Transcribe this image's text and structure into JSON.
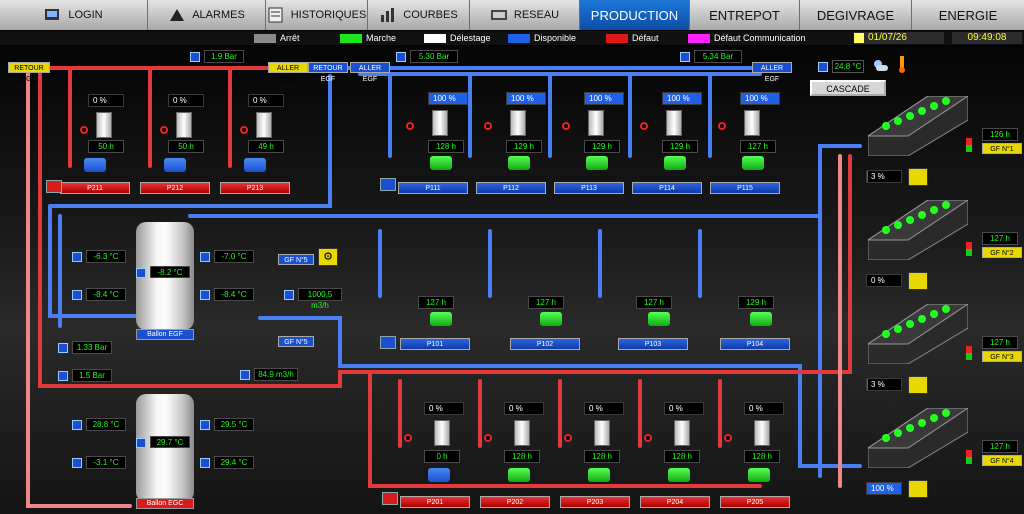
{
  "nav": {
    "login": "LOGIN",
    "alarms": "ALARMES",
    "history": "HISTORIQUES",
    "curves": "COURBES",
    "network": "RESEAU",
    "production": "PRODUCTION",
    "warehouse": "ENTREPOT",
    "defrost": "DEGIVRAGE",
    "energy": "ENERGIE"
  },
  "legend": {
    "stop": "Arrêt",
    "run": "Marche",
    "shed": "Délestage",
    "available": "Disponible",
    "fault": "Défaut",
    "comm_fault": "Défaut Communication",
    "date": "01/07/26",
    "time": "09:49:08"
  },
  "colors": {
    "stop": "#8a8a8a",
    "run": "#1ee61e",
    "shed": "#ffffff",
    "available": "#1e60e8",
    "fault": "#e01818",
    "comm_fault": "#ff22ff"
  },
  "top": {
    "p1": "1.9 Bar",
    "p2": "5.30 Bar",
    "p3": "5.34 Bar",
    "retour_egc": "RETOUR EGC",
    "aller_egc": "ALLER EGC",
    "retour_egf": "RETOUR EGF",
    "aller_egf1": "ALLER EGF",
    "aller_egf2": "ALLER EGF",
    "outdoor": "24.8 °C",
    "cascade": "CASCADE"
  },
  "egc_pumps": [
    {
      "name": "P211",
      "pct": "0 %",
      "pct_val": 0,
      "hours": "50 h"
    },
    {
      "name": "P212",
      "pct": "0 %",
      "pct_val": 0,
      "hours": "50 h"
    },
    {
      "name": "P213",
      "pct": "0 %",
      "pct_val": 0,
      "hours": "49 h"
    }
  ],
  "egf_pumps_top": [
    {
      "name": "P111",
      "pct": "100 %",
      "pct_val": 100,
      "hours": "128 h"
    },
    {
      "name": "P112",
      "pct": "100 %",
      "pct_val": 100,
      "hours": "129 h"
    },
    {
      "name": "P113",
      "pct": "100 %",
      "pct_val": 100,
      "hours": "129 h"
    },
    {
      "name": "P114",
      "pct": "100 %",
      "pct_val": 100,
      "hours": "129 h"
    },
    {
      "name": "P115",
      "pct": "100 %",
      "pct_val": 100,
      "hours": "127 h"
    }
  ],
  "egf_pumps_mid": [
    {
      "name": "P101",
      "hours": "127 h"
    },
    {
      "name": "P102",
      "hours": "127 h"
    },
    {
      "name": "P103",
      "hours": "127 h"
    },
    {
      "name": "P104",
      "hours": "129 h"
    }
  ],
  "egc_pumps_bottom": [
    {
      "name": "P201",
      "pct": "0 %",
      "pct_val": 0,
      "hours": "0 h"
    },
    {
      "name": "P202",
      "pct": "0 %",
      "pct_val": 0,
      "hours": "128 h"
    },
    {
      "name": "P203",
      "pct": "0 %",
      "pct_val": 0,
      "hours": "128 h"
    },
    {
      "name": "P204",
      "pct": "0 %",
      "pct_val": 0,
      "hours": "128 h"
    },
    {
      "name": "P205",
      "pct": "0 %",
      "pct_val": 0,
      "hours": "128 h"
    }
  ],
  "tank_egf": {
    "label": "Ballon EGF",
    "center": "-8.2 °C",
    "t1": "-6.3 °C",
    "t2": "-7.0 °C",
    "t3": "-8.4 °C",
    "t4": "-8.4 °C",
    "pressure": "1.33 Bar"
  },
  "tank_egc": {
    "label": "Ballon EGC",
    "center": "29.7 °C",
    "t1": "28.8 °C",
    "t2": "29.5 °C",
    "t3": "-3.1 °C",
    "t4": "29.4 °C",
    "pressure": "1.5 Bar"
  },
  "flow": {
    "egf": "1000.5 m3/h",
    "egc": "84.9 m3/h",
    "gf5_a": "GF N°5",
    "gf5_b": "GF N°5"
  },
  "groups": [
    {
      "label": "GF N°1",
      "hours": "126 h",
      "pct": "3 %",
      "pct_val": 3
    },
    {
      "label": "GF N°2",
      "hours": "127 h",
      "pct": "0 %",
      "pct_val": 0
    },
    {
      "label": "GF N°3",
      "hours": "127 h",
      "pct": "3 %",
      "pct_val": 3
    },
    {
      "label": "GF N°4",
      "hours": "127 h",
      "pct": "100 %",
      "pct_val": 100
    }
  ]
}
